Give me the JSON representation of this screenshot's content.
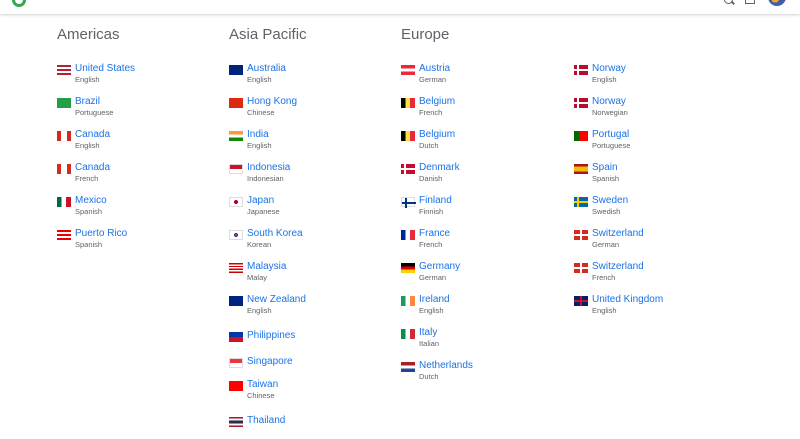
{
  "header": {
    "logo_icon": "google-logo-icon",
    "search_icon": "search-icon",
    "cart_icon": "cart-icon",
    "avatar_icon": "account-avatar"
  },
  "regions": [
    {
      "name": "Americas",
      "entries": [
        {
          "country": "United States",
          "language": "English",
          "flag": "flag-us"
        },
        {
          "country": "Brazil",
          "language": "Portuguese",
          "flag": "flag-br"
        },
        {
          "country": "Canada",
          "language": "English",
          "flag": "flag-ca"
        },
        {
          "country": "Canada",
          "language": "French",
          "flag": "flag-ca"
        },
        {
          "country": "Mexico",
          "language": "Spanish",
          "flag": "flag-mx"
        },
        {
          "country": "Puerto Rico",
          "language": "Spanish",
          "flag": "flag-pr"
        }
      ]
    },
    {
      "name": "Asia Pacific",
      "entries": [
        {
          "country": "Australia",
          "language": "English",
          "flag": "flag-au"
        },
        {
          "country": "Hong Kong",
          "language": "Chinese",
          "flag": "flag-hk"
        },
        {
          "country": "India",
          "language": "English",
          "flag": "flag-in"
        },
        {
          "country": "Indonesia",
          "language": "Indonesian",
          "flag": "flag-id"
        },
        {
          "country": "Japan",
          "language": "Japanese",
          "flag": "flag-jp"
        },
        {
          "country": "South Korea",
          "language": "Korean",
          "flag": "flag-kr"
        },
        {
          "country": "Malaysia",
          "language": "Malay",
          "flag": "flag-my"
        },
        {
          "country": "New Zealand",
          "language": "English",
          "flag": "flag-nz"
        },
        {
          "country": "Philippines",
          "language": "",
          "flag": "flag-ph"
        },
        {
          "country": "Singapore",
          "language": "",
          "flag": "flag-sg"
        },
        {
          "country": "Taiwan",
          "language": "Chinese",
          "flag": "flag-tw"
        },
        {
          "country": "Thailand",
          "language": "",
          "flag": "flag-th"
        }
      ]
    },
    {
      "name": "Europe",
      "entries": [
        {
          "country": "Austria",
          "language": "German",
          "flag": "flag-at"
        },
        {
          "country": "Belgium",
          "language": "French",
          "flag": "flag-be"
        },
        {
          "country": "Belgium",
          "language": "Dutch",
          "flag": "flag-be"
        },
        {
          "country": "Denmark",
          "language": "Danish",
          "flag": "flag-dk"
        },
        {
          "country": "Finland",
          "language": "Finnish",
          "flag": "flag-fi"
        },
        {
          "country": "France",
          "language": "French",
          "flag": "flag-fr"
        },
        {
          "country": "Germany",
          "language": "German",
          "flag": "flag-de"
        },
        {
          "country": "Ireland",
          "language": "English",
          "flag": "flag-ie"
        },
        {
          "country": "Italy",
          "language": "Italian",
          "flag": "flag-it"
        },
        {
          "country": "Netherlands",
          "language": "Dutch",
          "flag": "flag-nl"
        }
      ]
    },
    {
      "name": "",
      "entries": [
        {
          "country": "Norway",
          "language": "English",
          "flag": "flag-no"
        },
        {
          "country": "Norway",
          "language": "Norwegian",
          "flag": "flag-no"
        },
        {
          "country": "Portugal",
          "language": "Portuguese",
          "flag": "flag-pt"
        },
        {
          "country": "Spain",
          "language": "Spanish",
          "flag": "flag-es"
        },
        {
          "country": "Sweden",
          "language": "Swedish",
          "flag": "flag-se"
        },
        {
          "country": "Switzerland",
          "language": "German",
          "flag": "flag-ch"
        },
        {
          "country": "Switzerland",
          "language": "French",
          "flag": "flag-ch"
        },
        {
          "country": "United Kingdom",
          "language": "English",
          "flag": "flag-gb"
        }
      ]
    }
  ]
}
